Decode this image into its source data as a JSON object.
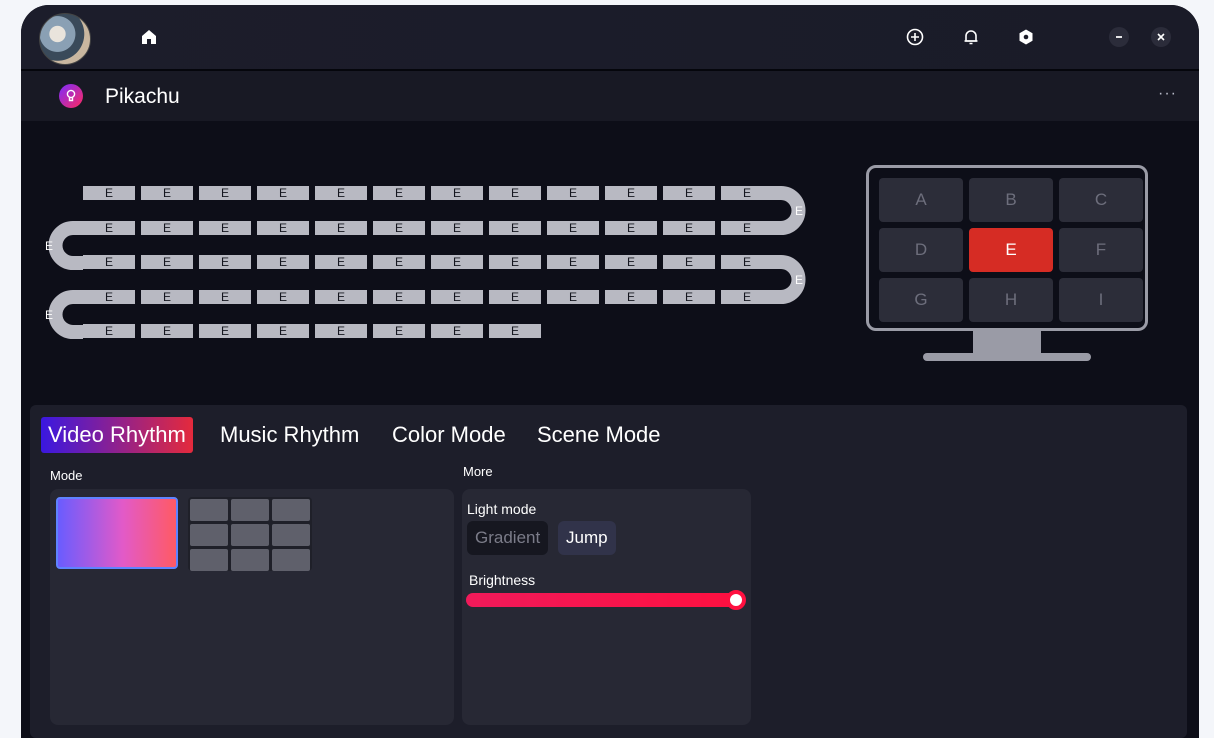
{
  "device": {
    "name": "Pikachu"
  },
  "topbar": {
    "icons": [
      "home-icon",
      "add-circle-icon",
      "bell-icon",
      "hexagon-settings-icon",
      "minimize-icon",
      "close-icon"
    ]
  },
  "strip": {
    "segment_label": "E",
    "rows": [
      {
        "count": 12
      },
      {
        "count": 12
      },
      {
        "count": 12
      },
      {
        "count": 12
      },
      {
        "count": 8
      }
    ],
    "turn_label": "E"
  },
  "monitor": {
    "zones": [
      "A",
      "B",
      "C",
      "D",
      "E",
      "F",
      "G",
      "H",
      "I"
    ],
    "active_zone": "E"
  },
  "tabs": [
    {
      "label": "Video Rhythm",
      "active": true
    },
    {
      "label": "Music Rhythm",
      "active": false
    },
    {
      "label": "Color Mode",
      "active": false
    },
    {
      "label": "Scene Mode",
      "active": false
    }
  ],
  "mode_section": {
    "label": "Mode"
  },
  "more_section": {
    "label": "More",
    "light_mode_label": "Light mode",
    "light_modes": [
      {
        "label": "Gradient",
        "selected": false
      },
      {
        "label": "Jump",
        "selected": true
      }
    ],
    "brightness_label": "Brightness",
    "brightness_percent": 100
  },
  "colors": {
    "accent_gradient_start": "#3a18e0",
    "accent_gradient_end": "#e42a3c",
    "active_zone": "#d62c24",
    "slider": "#ff1040"
  }
}
